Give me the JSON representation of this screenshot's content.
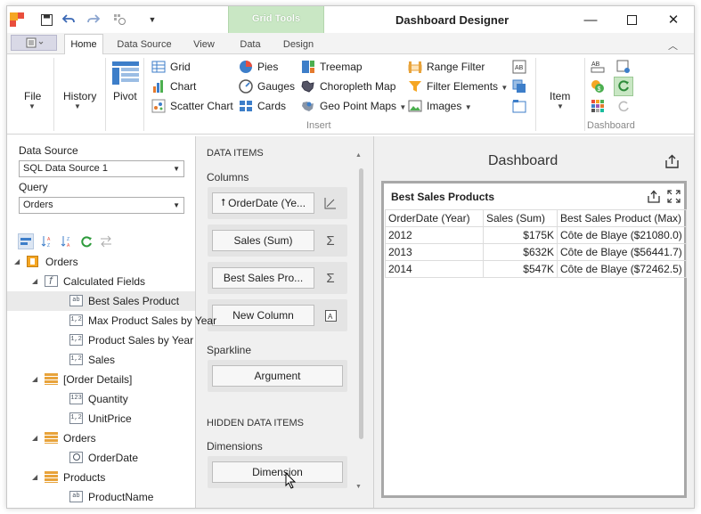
{
  "window": {
    "title": "Dashboard Designer",
    "contextual_group": "Grid Tools"
  },
  "tabs": [
    "Home",
    "Data Source",
    "View",
    "Data",
    "Design"
  ],
  "ribbon": {
    "file": "File",
    "history": "History",
    "pivot": "Pivot",
    "col1": [
      "Grid",
      "Chart",
      "Scatter Chart"
    ],
    "col2": [
      "Pies",
      "Gauges",
      "Cards"
    ],
    "col3": [
      "Treemap",
      "Choropleth Map",
      "Geo Point Maps"
    ],
    "col4": [
      "Range Filter",
      "Filter Elements",
      "Images"
    ],
    "insert_group": "Insert",
    "item": "Item",
    "dashboard_group": "Dashboard"
  },
  "left_panel": {
    "data_source_label": "Data Source",
    "data_source_value": "SQL Data Source 1",
    "query_label": "Query",
    "query_value": "Orders",
    "tree": [
      {
        "label": "Orders",
        "level": 0,
        "icon": "table-root"
      },
      {
        "label": "Calculated Fields",
        "level": 1,
        "icon": "function"
      },
      {
        "label": "Best Sales Product",
        "level": 2,
        "icon": "ab"
      },
      {
        "label": "Max Product Sales by Year",
        "level": 2,
        "icon": "1,2"
      },
      {
        "label": "Product Sales by Year",
        "level": 2,
        "icon": "1,2"
      },
      {
        "label": "Sales",
        "level": 2,
        "icon": "1,2"
      },
      {
        "label": "[Order Details]",
        "level": 1,
        "icon": "table"
      },
      {
        "label": "Quantity",
        "level": 2,
        "icon": "123"
      },
      {
        "label": "UnitPrice",
        "level": 2,
        "icon": "1,2"
      },
      {
        "label": "Orders",
        "level": 1,
        "icon": "table"
      },
      {
        "label": "OrderDate",
        "level": 2,
        "icon": "clock"
      },
      {
        "label": "Products",
        "level": 1,
        "icon": "table"
      },
      {
        "label": "ProductName",
        "level": 2,
        "icon": "ab"
      }
    ]
  },
  "data_items": {
    "header": "DATA ITEMS",
    "columns_label": "Columns",
    "columns": [
      "OrderDate (Ye...",
      "Sales (Sum)",
      "Best Sales Pro...",
      "New Column"
    ],
    "sparkline_label": "Sparkline",
    "sparkline_button": "Argument",
    "hidden_header": "HIDDEN DATA ITEMS",
    "dimensions_label": "Dimensions",
    "dimension_button": "Dimension"
  },
  "dashboard": {
    "title": "Dashboard",
    "grid_title": "Best Sales Products",
    "columns": [
      "OrderDate (Year)",
      "Sales (Sum)",
      "Best Sales Product (Max)"
    ],
    "rows": [
      [
        "2012",
        "$175K",
        "Côte de Blaye ($21080.0)"
      ],
      [
        "2013",
        "$632K",
        "Côte de Blaye ($56441.7)"
      ],
      [
        "2014",
        "$547K",
        "Côte de Blaye ($72462.5)"
      ]
    ]
  }
}
